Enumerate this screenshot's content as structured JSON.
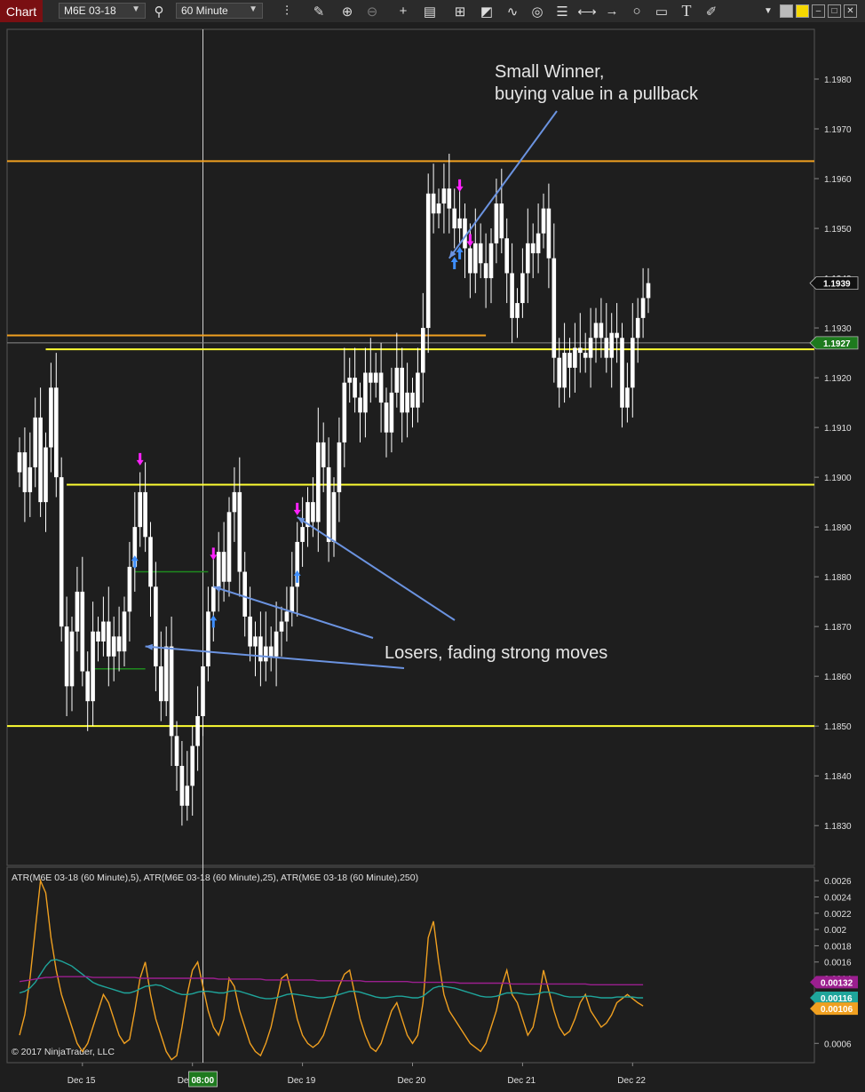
{
  "toolbar": {
    "tab_label": "Chart",
    "instrument": "M6E 03-18",
    "interval": "60 Minute",
    "icons": [
      "search-icon",
      "bar-type-icon",
      "draw-icon",
      "zoom-in-icon",
      "zoom-out-icon",
      "crosshair-icon",
      "data-box-icon",
      "strategies-icon",
      "indicators-icon",
      "wave-icon",
      "properties-icon",
      "templates-icon",
      "line-icon",
      "arrow-icon",
      "ellipse-icon",
      "rectangle-icon",
      "text-icon",
      "tools-icon"
    ],
    "window_buttons": [
      "menu-caret-icon",
      "tile-icon",
      "colour-icon",
      "minimize-icon",
      "maximize-icon",
      "close-icon"
    ]
  },
  "colors": {
    "background": "#1e1e1e",
    "candle": "#ffffff",
    "orange_line": "#f0a020",
    "yellow_line": "#ffff33",
    "annotation_arrow": "#6b93e0",
    "buy_arrow": "#3f8fff",
    "sell_arrow": "#ff22ff",
    "atr_fast": "#f0a020",
    "atr_mid": "#1fa59b",
    "atr_slow": "#9b1f8f",
    "last_price_badge": "#1e7a1e"
  },
  "chart_data": {
    "type": "candlestick",
    "title": "",
    "instrument": "M6E 03-18",
    "interval": "60 Minute",
    "ylim": [
      1.1822,
      1.199
    ],
    "y_ticks": [
      "1.1980",
      "1.1970",
      "1.1960",
      "1.1950",
      "1.1940",
      "1.1930",
      "1.1920",
      "1.1910",
      "1.1900",
      "1.1890",
      "1.1880",
      "1.1870",
      "1.1860",
      "1.1850",
      "1.1840",
      "1.1830"
    ],
    "y_tick_values": [
      1.198,
      1.197,
      1.196,
      1.195,
      1.194,
      1.193,
      1.192,
      1.191,
      1.19,
      1.189,
      1.188,
      1.187,
      1.186,
      1.185,
      1.184,
      1.183
    ],
    "x_labels": [
      "Dec 15",
      "Dec 18",
      "Dec 19",
      "Dec 20",
      "Dec 21",
      "Dec 22"
    ],
    "x_label_index": [
      12,
      33,
      54,
      75,
      96,
      117
    ],
    "crosshair_time": "08:00",
    "crosshair_index": 35,
    "price_badges": [
      {
        "label": "1.1939",
        "value": 1.1939,
        "style": "dark"
      },
      {
        "label": "1.1927",
        "value": 1.1927,
        "style": "green"
      }
    ],
    "closes": [
      1.1905,
      1.1897,
      1.1902,
      1.1912,
      1.1895,
      1.1906,
      1.1918,
      1.19,
      1.187,
      1.1858,
      1.1869,
      1.1877,
      1.1861,
      1.1855,
      1.1869,
      1.1867,
      1.1871,
      1.1864,
      1.1868,
      1.1865,
      1.1873,
      1.1882,
      1.189,
      1.1897,
      1.1888,
      1.1878,
      1.1862,
      1.1855,
      1.1866,
      1.1848,
      1.1842,
      1.1834,
      1.1838,
      1.1846,
      1.1852,
      1.1862,
      1.1873,
      1.1878,
      1.1885,
      1.1879,
      1.1893,
      1.1897,
      1.1881,
      1.1872,
      1.1866,
      1.1868,
      1.1863,
      1.1866,
      1.1864,
      1.1869,
      1.1871,
      1.1873,
      1.1878,
      1.1887,
      1.189,
      1.1895,
      1.1891,
      1.1907,
      1.1902,
      1.1887,
      1.1897,
      1.1907,
      1.1919,
      1.192,
      1.1916,
      1.1913,
      1.1921,
      1.1919,
      1.1921,
      1.1915,
      1.1909,
      1.1917,
      1.1922,
      1.1913,
      1.1917,
      1.1914,
      1.1921,
      1.193,
      1.1957,
      1.1953,
      1.1955,
      1.1958,
      1.1954,
      1.195,
      1.1952,
      1.1946,
      1.1941,
      1.1947,
      1.1943,
      1.194,
      1.1947,
      1.1955,
      1.1948,
      1.1941,
      1.1932,
      1.1935,
      1.1941,
      1.1947,
      1.1945,
      1.1949,
      1.1954,
      1.1944,
      1.1924,
      1.1918,
      1.1925,
      1.1922,
      1.1926,
      1.1925,
      1.1924,
      1.1928,
      1.1931,
      1.1928,
      1.1924,
      1.1929,
      1.1928,
      1.1914,
      1.1918,
      1.1928,
      1.1932,
      1.1936,
      1.1939
    ],
    "series": [
      {
        "name": "ATR(M6E 03-18 (60 Minute),5)",
        "role": "fast",
        "last": "0.00106",
        "values": [
          0.0007,
          0.00095,
          0.0014,
          0.002,
          0.0026,
          0.00245,
          0.0019,
          0.0015,
          0.0012,
          0.001,
          0.0008,
          0.0006,
          0.0005,
          0.0006,
          0.0008,
          0.001,
          0.0012,
          0.0011,
          0.0009,
          0.0007,
          0.0006,
          0.00065,
          0.001,
          0.0014,
          0.0016,
          0.0012,
          0.0009,
          0.0007,
          0.0005,
          0.0004,
          0.00045,
          0.0008,
          0.0012,
          0.0015,
          0.0016,
          0.0013,
          0.001,
          0.0008,
          0.0007,
          0.0009,
          0.0014,
          0.0013,
          0.001,
          0.0008,
          0.0006,
          0.0005,
          0.00045,
          0.0006,
          0.0008,
          0.0011,
          0.0014,
          0.00145,
          0.0012,
          0.0009,
          0.0007,
          0.0006,
          0.00055,
          0.0006,
          0.0007,
          0.0009,
          0.0011,
          0.0013,
          0.00145,
          0.0015,
          0.0012,
          0.0009,
          0.0007,
          0.00055,
          0.0005,
          0.0006,
          0.0008,
          0.001,
          0.0011,
          0.0009,
          0.0007,
          0.0006,
          0.0007,
          0.0011,
          0.0019,
          0.0021,
          0.0016,
          0.0012,
          0.001,
          0.0009,
          0.0008,
          0.0007,
          0.0006,
          0.00055,
          0.0005,
          0.0006,
          0.0008,
          0.001,
          0.0013,
          0.0015,
          0.0012,
          0.0011,
          0.0009,
          0.0007,
          0.0008,
          0.0011,
          0.0015,
          0.00125,
          0.001,
          0.0008,
          0.0007,
          0.00075,
          0.0009,
          0.0011,
          0.0012,
          0.001,
          0.0009,
          0.0008,
          0.00085,
          0.00095,
          0.0011,
          0.00115,
          0.0012,
          0.00115,
          0.0011,
          0.00106
        ]
      },
      {
        "name": "ATR(M6E 03-18 (60 Minute),25)",
        "role": "mid",
        "last": "0.00116",
        "values": [
          0.00122,
          0.00124,
          0.00128,
          0.00135,
          0.00145,
          0.00155,
          0.00162,
          0.00163,
          0.00161,
          0.00158,
          0.00155,
          0.0015,
          0.00145,
          0.0014,
          0.00135,
          0.00132,
          0.0013,
          0.00128,
          0.00126,
          0.00124,
          0.00122,
          0.00122,
          0.00124,
          0.00127,
          0.0013,
          0.00131,
          0.00132,
          0.00131,
          0.00128,
          0.00125,
          0.00122,
          0.0012,
          0.0012,
          0.00121,
          0.00123,
          0.00124,
          0.00124,
          0.00123,
          0.00122,
          0.00122,
          0.00124,
          0.00125,
          0.00124,
          0.00122,
          0.0012,
          0.00118,
          0.00116,
          0.00115,
          0.00115,
          0.00116,
          0.00118,
          0.0012,
          0.00121,
          0.0012,
          0.00119,
          0.00118,
          0.00117,
          0.00116,
          0.00116,
          0.00117,
          0.00118,
          0.0012,
          0.00122,
          0.00124,
          0.00124,
          0.00123,
          0.00121,
          0.00119,
          0.00117,
          0.00116,
          0.00116,
          0.00117,
          0.00118,
          0.00118,
          0.00117,
          0.00116,
          0.00116,
          0.00118,
          0.00123,
          0.00128,
          0.0013,
          0.0013,
          0.00129,
          0.00128,
          0.00126,
          0.00124,
          0.00122,
          0.0012,
          0.00118,
          0.00117,
          0.00117,
          0.00118,
          0.0012,
          0.00122,
          0.00122,
          0.00122,
          0.00121,
          0.0012,
          0.0012,
          0.00121,
          0.00123,
          0.00123,
          0.00122,
          0.0012,
          0.00118,
          0.00117,
          0.00117,
          0.00117,
          0.00118,
          0.00118,
          0.00117,
          0.00116,
          0.00116,
          0.00116,
          0.00117,
          0.00117,
          0.00117,
          0.00117,
          0.00116,
          0.00116
        ]
      },
      {
        "name": "ATR(M6E 03-18 (60 Minute),250)",
        "role": "slow",
        "last": "0.00132",
        "values": [
          0.00136,
          0.00137,
          0.00138,
          0.00139,
          0.0014,
          0.00141,
          0.00141,
          0.00142,
          0.00142,
          0.00142,
          0.00142,
          0.00142,
          0.00142,
          0.00142,
          0.00141,
          0.00141,
          0.00141,
          0.00141,
          0.00141,
          0.00141,
          0.00141,
          0.00141,
          0.00141,
          0.0014,
          0.0014,
          0.0014,
          0.0014,
          0.0014,
          0.0014,
          0.0014,
          0.0014,
          0.0014,
          0.0014,
          0.0014,
          0.0014,
          0.0014,
          0.0014,
          0.0014,
          0.00139,
          0.00139,
          0.00139,
          0.00139,
          0.00139,
          0.00139,
          0.00139,
          0.00139,
          0.00139,
          0.00138,
          0.00138,
          0.00138,
          0.00138,
          0.00138,
          0.00138,
          0.00138,
          0.00138,
          0.00138,
          0.00138,
          0.00137,
          0.00137,
          0.00137,
          0.00137,
          0.00137,
          0.00137,
          0.00137,
          0.00137,
          0.00137,
          0.00136,
          0.00136,
          0.00136,
          0.00136,
          0.00136,
          0.00136,
          0.00136,
          0.00136,
          0.00136,
          0.00135,
          0.00135,
          0.00135,
          0.00135,
          0.00135,
          0.00135,
          0.00135,
          0.00135,
          0.00135,
          0.00134,
          0.00134,
          0.00134,
          0.00134,
          0.00134,
          0.00134,
          0.00134,
          0.00134,
          0.00134,
          0.00134,
          0.00133,
          0.00133,
          0.00133,
          0.00133,
          0.00133,
          0.00133,
          0.00133,
          0.00133,
          0.00133,
          0.00133,
          0.00133,
          0.00133,
          0.00133,
          0.00133,
          0.00133,
          0.00132,
          0.00132,
          0.00132,
          0.00132,
          0.00132,
          0.00132,
          0.00132,
          0.00132,
          0.00132,
          0.00132,
          0.00132
        ]
      }
    ],
    "atr_ylim": [
      0.00045,
      0.0027
    ],
    "atr_ticks": [
      "0.0026",
      "0.0024",
      "0.0022",
      "0.002",
      "0.0018",
      "0.0016",
      "0.0014",
      "0.0006"
    ],
    "atr_tick_values": [
      0.0026,
      0.0024,
      0.0022,
      0.002,
      0.0018,
      0.0016,
      0.0014,
      0.0006
    ],
    "atr_badges": [
      {
        "label": "0.00132",
        "value": 0.00132,
        "color": "#9b1f8f"
      },
      {
        "label": "0.00116",
        "value": 0.00116,
        "color": "#1fa59b"
      },
      {
        "label": "0.00106",
        "value": 0.00106,
        "color": "#f0a020"
      }
    ],
    "atr_panel_label": "ATR(M6E 03-18 (60 Minute),5), ATR(M6E 03-18 (60 Minute),25), ATR(M6E 03-18 (60 Minute),250)",
    "copyright": "© 2017 NinjaTrader, LLC",
    "levels": [
      {
        "value": 1.19635,
        "color": "orange",
        "from_index": 0,
        "to_index": 120
      },
      {
        "value": 1.19285,
        "color": "orange",
        "from_index": 0,
        "to_index": 89
      },
      {
        "value": 1.19257,
        "color": "yellow",
        "from_index": 5,
        "to_index": 120
      },
      {
        "value": 1.18985,
        "color": "yellow",
        "from_index": 9,
        "to_index": 120
      },
      {
        "value": 1.185,
        "color": "yellow",
        "from_index": 0,
        "to_index": 120
      }
    ],
    "green_levels": [
      {
        "value": 1.1881,
        "from_index": 22,
        "to_index": 36
      },
      {
        "value": 1.18615,
        "from_index": 14,
        "to_index": 24
      }
    ],
    "buy_arrows": [
      22,
      37,
      53,
      83,
      84
    ],
    "sell_arrows": [
      23,
      37,
      53,
      84,
      86
    ],
    "annotations": [
      {
        "text_lines": [
          "Small Winner,",
          "buying value in a pullback"
        ],
        "arrow_to": [
          82,
          1.1944
        ]
      },
      {
        "text_lines": [
          "Losers, fading strong moves"
        ],
        "arrow_to": [
          [
            24,
            1.1866
          ],
          [
            37,
            1.1878
          ],
          [
            53,
            1.1892
          ]
        ]
      }
    ]
  }
}
